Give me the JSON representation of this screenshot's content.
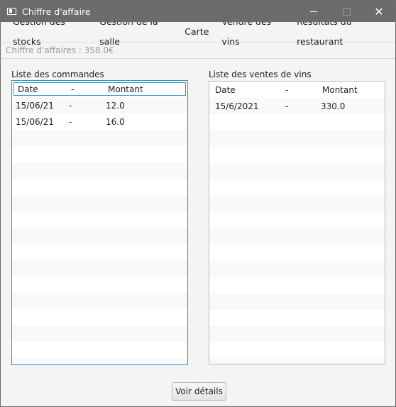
{
  "window": {
    "title": "Chiffre d'affaire",
    "close_glyph": "✕"
  },
  "menu": [
    "Gestion des stocks",
    "Gestion de la salle",
    "Carte",
    "Vendre des vins",
    "Résultats du restaurant"
  ],
  "status": "Chiffre d'affaires : 358.0€",
  "orders": {
    "label": "Liste des commandes",
    "headers": {
      "date": "Date",
      "sep": "-",
      "amount": "Montant"
    },
    "rows": [
      {
        "date": "15/06/21",
        "sep": "-",
        "amount": "12.0"
      },
      {
        "date": "15/06/21",
        "sep": "-",
        "amount": "16.0"
      }
    ]
  },
  "wines": {
    "label": "Liste des ventes de vins",
    "headers": {
      "date": "Date",
      "sep": "-",
      "amount": "Montant"
    },
    "rows": [
      {
        "date": "15/6/2021",
        "sep": "-",
        "amount": "330.0"
      }
    ]
  },
  "details_button": "Voir détails"
}
